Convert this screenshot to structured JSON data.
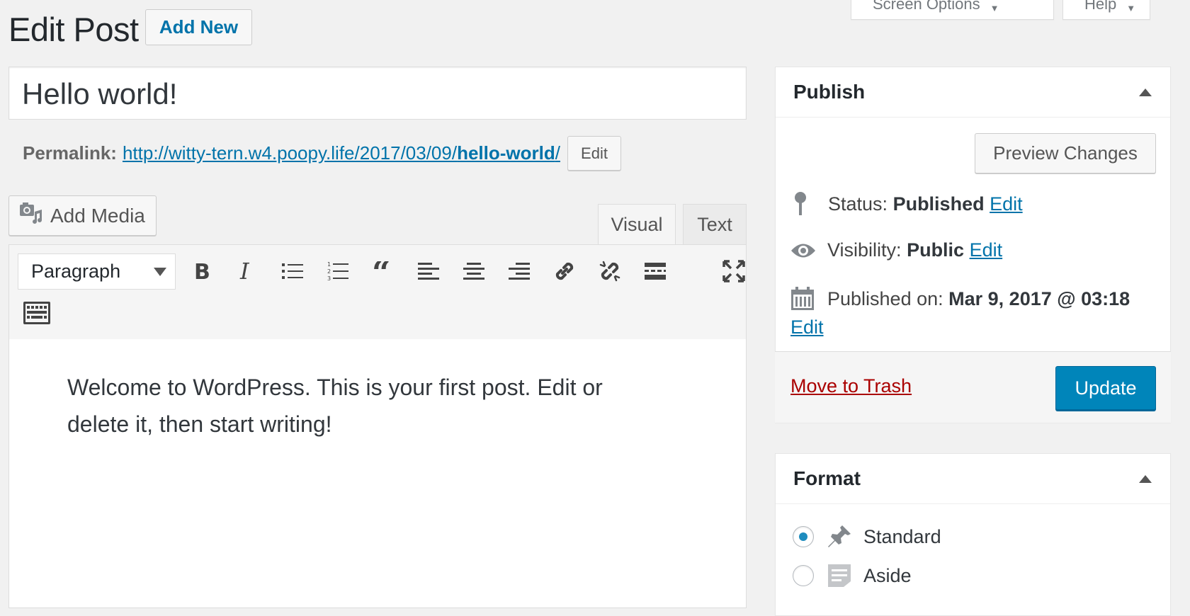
{
  "header": {
    "page_title": "Edit Post",
    "add_new_label": "Add New",
    "screen_options_label": "Screen Options",
    "help_label": "Help"
  },
  "post": {
    "title": "Hello world!",
    "permalink_label": "Permalink:",
    "permalink_base": "http://witty-tern.w4.poopy.life/2017/03/09/",
    "permalink_slug": "hello-world",
    "permalink_trailing": "/",
    "permalink_edit_label": "Edit"
  },
  "editor": {
    "add_media_label": "Add Media",
    "tabs": {
      "visual": "Visual",
      "text": "Text"
    },
    "format_select_value": "Paragraph",
    "toolbar_icons": [
      "bold-icon",
      "italic-icon",
      "bulleted-list-icon",
      "numbered-list-icon",
      "blockquote-icon",
      "align-left-icon",
      "align-center-icon",
      "align-right-icon",
      "insert-link-icon",
      "remove-link-icon",
      "read-more-icon",
      "fullscreen-icon",
      "toolbar-toggle-icon"
    ],
    "content": "Welcome to WordPress. This is your first post. Edit or delete it, then start writing!"
  },
  "publish_box": {
    "title": "Publish",
    "preview_label": "Preview Changes",
    "status_label": "Status:",
    "status_value": "Published",
    "visibility_label": "Visibility:",
    "visibility_value": "Public",
    "published_on_label": "Published on:",
    "published_on_value": "Mar 9, 2017 @ 03:18",
    "edit_label": "Edit",
    "trash_label": "Move to Trash",
    "update_label": "Update"
  },
  "format_box": {
    "title": "Format",
    "options": [
      {
        "label": "Standard",
        "selected": true
      },
      {
        "label": "Aside",
        "selected": false
      }
    ]
  },
  "colors": {
    "link": "#0073aa",
    "primary_button": "#0085ba",
    "trash": "#a00",
    "background": "#f1f1f1"
  }
}
